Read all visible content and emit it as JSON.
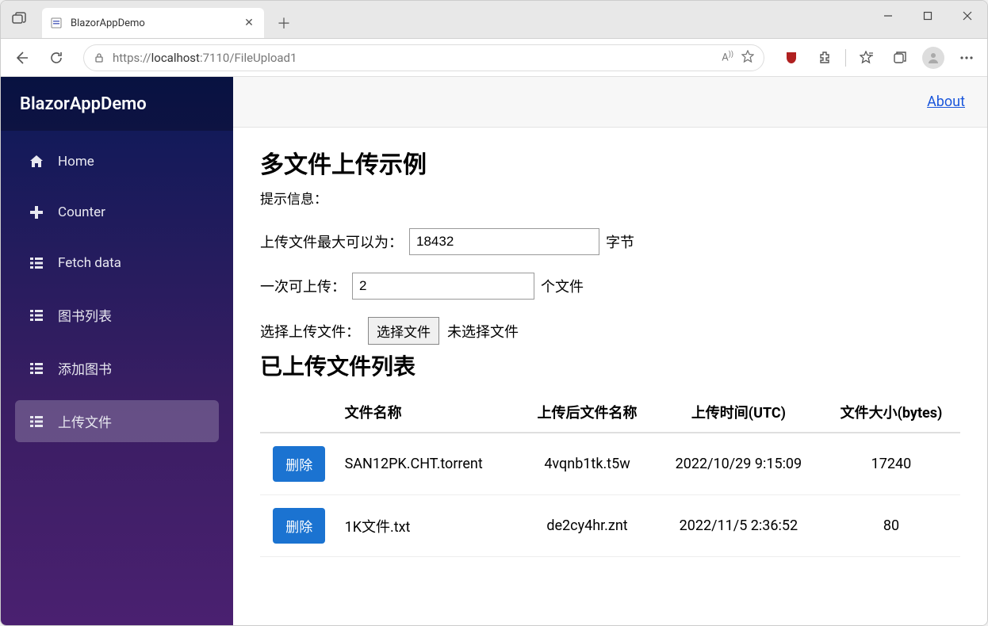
{
  "browser": {
    "tab_title": "BlazorAppDemo",
    "url_scheme": "https://",
    "url_host": "localhost",
    "url_port": ":7110",
    "url_path": "/FileUpload1"
  },
  "brand": "BlazorAppDemo",
  "sidebar": {
    "items": [
      {
        "label": "Home",
        "icon": "home"
      },
      {
        "label": "Counter",
        "icon": "plus"
      },
      {
        "label": "Fetch data",
        "icon": "list"
      },
      {
        "label": "图书列表",
        "icon": "list"
      },
      {
        "label": "添加图书",
        "icon": "list"
      },
      {
        "label": "上传文件",
        "icon": "list"
      }
    ]
  },
  "top": {
    "about": "About"
  },
  "page": {
    "title": "多文件上传示例",
    "hint_label": "提示信息：",
    "max_label": "上传文件最大可以为：",
    "max_value": "18432",
    "max_suffix": "字节",
    "count_label": "一次可上传：",
    "count_value": "2",
    "count_suffix": "个文件",
    "select_label": "选择上传文件：",
    "file_button": "选择文件",
    "file_status": "未选择文件",
    "list_title": "已上传文件列表"
  },
  "table": {
    "headers": {
      "action": "",
      "name": "文件名称",
      "stored": "上传后文件名称",
      "time": "上传时间(UTC)",
      "size": "文件大小(bytes)"
    },
    "delete_label": "删除",
    "rows": [
      {
        "name": "SAN12PK.CHT.torrent",
        "stored": "4vqnb1tk.t5w",
        "time": "2022/10/29 9:15:09",
        "size": "17240"
      },
      {
        "name": "1K文件.txt",
        "stored": "de2cy4hr.znt",
        "time": "2022/11/5 2:36:52",
        "size": "80"
      }
    ]
  }
}
